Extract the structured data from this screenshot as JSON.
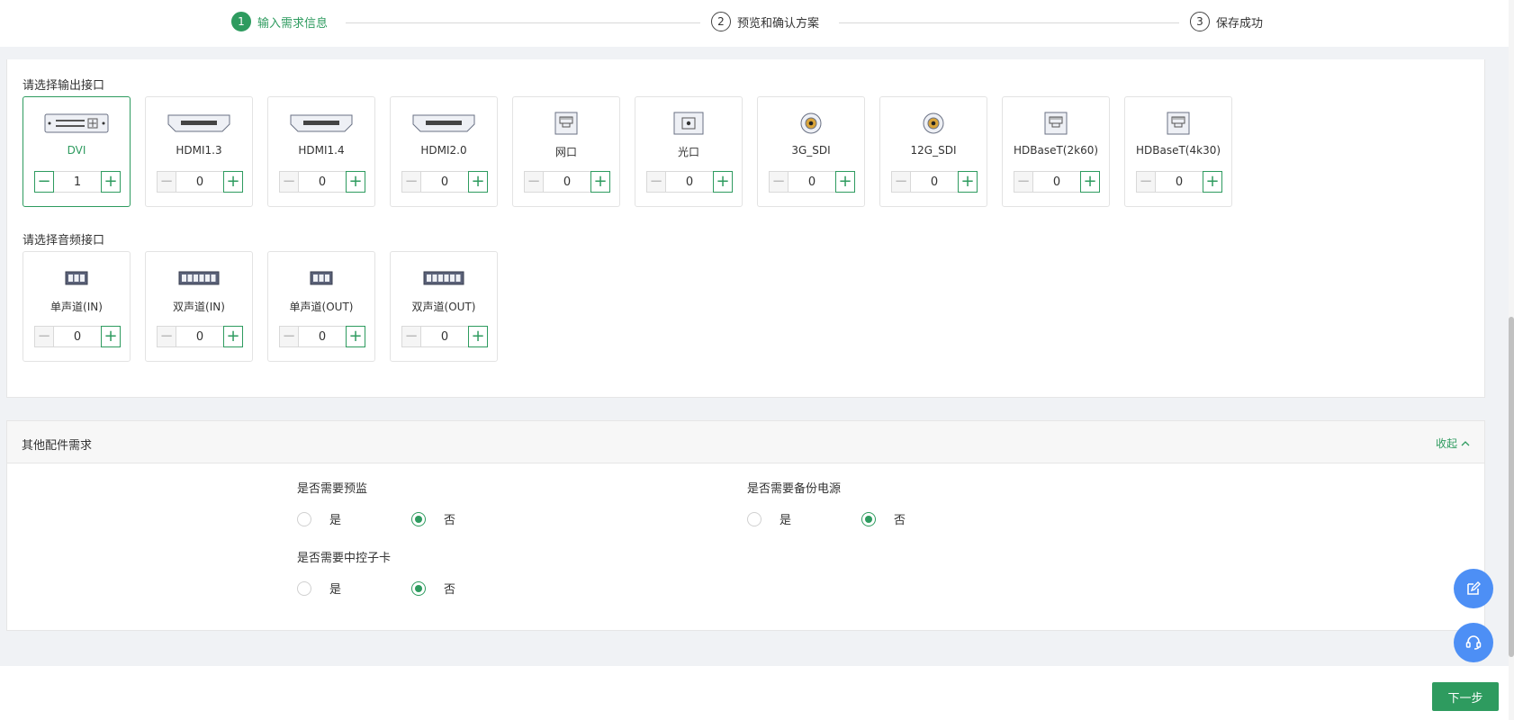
{
  "steps": [
    {
      "num": "1",
      "label": "输入需求信息"
    },
    {
      "num": "2",
      "label": "预览和确认方案"
    },
    {
      "num": "3",
      "label": "保存成功"
    }
  ],
  "output_section": {
    "title": "请选择输出接口",
    "items": [
      {
        "name": "DVI",
        "value": "1",
        "icon": "dvi-port-icon"
      },
      {
        "name": "HDMI1.3",
        "value": "0",
        "icon": "hdmi-port-icon"
      },
      {
        "name": "HDMI1.4",
        "value": "0",
        "icon": "hdmi-port-icon"
      },
      {
        "name": "HDMI2.0",
        "value": "0",
        "icon": "hdmi-port-icon"
      },
      {
        "name": "网口",
        "value": "0",
        "icon": "ethernet-port-icon"
      },
      {
        "name": "光口",
        "value": "0",
        "icon": "optical-port-icon"
      },
      {
        "name": "3G_SDI",
        "value": "0",
        "icon": "sdi-port-icon"
      },
      {
        "name": "12G_SDI",
        "value": "0",
        "icon": "sdi-port-icon"
      },
      {
        "name": "HDBaseT(2k60)",
        "value": "0",
        "icon": "hdbaset-port-icon"
      },
      {
        "name": "HDBaseT(4k30)",
        "value": "0",
        "icon": "hdbaset-port-icon"
      }
    ]
  },
  "audio_section": {
    "title": "请选择音频接口",
    "items": [
      {
        "name": "单声道(IN)",
        "value": "0",
        "icon": "terminal-3pin-icon"
      },
      {
        "name": "双声道(IN)",
        "value": "0",
        "icon": "terminal-6pin-icon"
      },
      {
        "name": "单声道(OUT)",
        "value": "0",
        "icon": "terminal-3pin-icon"
      },
      {
        "name": "双声道(OUT)",
        "value": "0",
        "icon": "terminal-6pin-icon"
      }
    ]
  },
  "stepper": {
    "minus": "−",
    "plus": "+"
  },
  "accessories": {
    "title": "其他配件需求",
    "collapse_label": "收起",
    "questions": [
      {
        "label": "是否需要预监",
        "yes": "是",
        "no": "否",
        "selected": "no"
      },
      {
        "label": "是否需要备份电源",
        "yes": "是",
        "no": "否",
        "selected": "no"
      },
      {
        "label": "是否需要中控子卡",
        "yes": "是",
        "no": "否",
        "selected": "no"
      }
    ]
  },
  "footer": {
    "next_label": "下一步"
  },
  "colors": {
    "accent": "#2e9b5f",
    "fab": "#4d8ff5"
  }
}
